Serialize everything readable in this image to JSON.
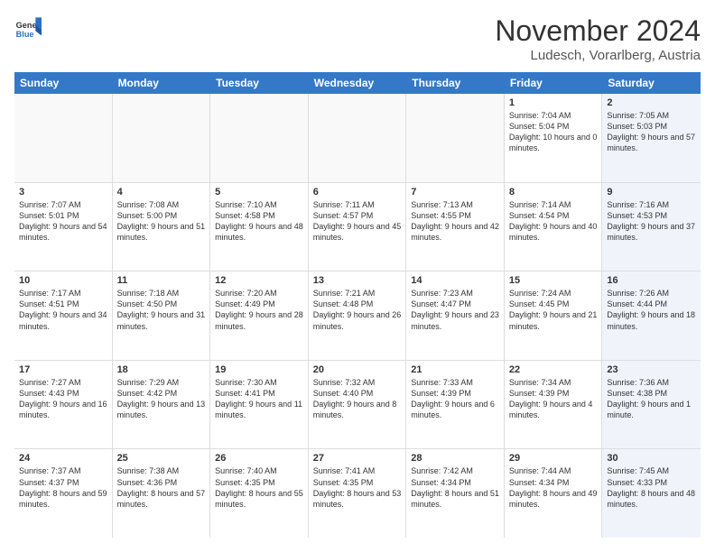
{
  "logo": {
    "general": "General",
    "blue": "Blue"
  },
  "header": {
    "month": "November 2024",
    "location": "Ludesch, Vorarlberg, Austria"
  },
  "weekdays": [
    "Sunday",
    "Monday",
    "Tuesday",
    "Wednesday",
    "Thursday",
    "Friday",
    "Saturday"
  ],
  "rows": [
    [
      {
        "day": "",
        "text": ""
      },
      {
        "day": "",
        "text": ""
      },
      {
        "day": "",
        "text": ""
      },
      {
        "day": "",
        "text": ""
      },
      {
        "day": "",
        "text": ""
      },
      {
        "day": "1",
        "text": "Sunrise: 7:04 AM\nSunset: 5:04 PM\nDaylight: 10 hours and 0 minutes."
      },
      {
        "day": "2",
        "text": "Sunrise: 7:05 AM\nSunset: 5:03 PM\nDaylight: 9 hours and 57 minutes."
      }
    ],
    [
      {
        "day": "3",
        "text": "Sunrise: 7:07 AM\nSunset: 5:01 PM\nDaylight: 9 hours and 54 minutes."
      },
      {
        "day": "4",
        "text": "Sunrise: 7:08 AM\nSunset: 5:00 PM\nDaylight: 9 hours and 51 minutes."
      },
      {
        "day": "5",
        "text": "Sunrise: 7:10 AM\nSunset: 4:58 PM\nDaylight: 9 hours and 48 minutes."
      },
      {
        "day": "6",
        "text": "Sunrise: 7:11 AM\nSunset: 4:57 PM\nDaylight: 9 hours and 45 minutes."
      },
      {
        "day": "7",
        "text": "Sunrise: 7:13 AM\nSunset: 4:55 PM\nDaylight: 9 hours and 42 minutes."
      },
      {
        "day": "8",
        "text": "Sunrise: 7:14 AM\nSunset: 4:54 PM\nDaylight: 9 hours and 40 minutes."
      },
      {
        "day": "9",
        "text": "Sunrise: 7:16 AM\nSunset: 4:53 PM\nDaylight: 9 hours and 37 minutes."
      }
    ],
    [
      {
        "day": "10",
        "text": "Sunrise: 7:17 AM\nSunset: 4:51 PM\nDaylight: 9 hours and 34 minutes."
      },
      {
        "day": "11",
        "text": "Sunrise: 7:18 AM\nSunset: 4:50 PM\nDaylight: 9 hours and 31 minutes."
      },
      {
        "day": "12",
        "text": "Sunrise: 7:20 AM\nSunset: 4:49 PM\nDaylight: 9 hours and 28 minutes."
      },
      {
        "day": "13",
        "text": "Sunrise: 7:21 AM\nSunset: 4:48 PM\nDaylight: 9 hours and 26 minutes."
      },
      {
        "day": "14",
        "text": "Sunrise: 7:23 AM\nSunset: 4:47 PM\nDaylight: 9 hours and 23 minutes."
      },
      {
        "day": "15",
        "text": "Sunrise: 7:24 AM\nSunset: 4:45 PM\nDaylight: 9 hours and 21 minutes."
      },
      {
        "day": "16",
        "text": "Sunrise: 7:26 AM\nSunset: 4:44 PM\nDaylight: 9 hours and 18 minutes."
      }
    ],
    [
      {
        "day": "17",
        "text": "Sunrise: 7:27 AM\nSunset: 4:43 PM\nDaylight: 9 hours and 16 minutes."
      },
      {
        "day": "18",
        "text": "Sunrise: 7:29 AM\nSunset: 4:42 PM\nDaylight: 9 hours and 13 minutes."
      },
      {
        "day": "19",
        "text": "Sunrise: 7:30 AM\nSunset: 4:41 PM\nDaylight: 9 hours and 11 minutes."
      },
      {
        "day": "20",
        "text": "Sunrise: 7:32 AM\nSunset: 4:40 PM\nDaylight: 9 hours and 8 minutes."
      },
      {
        "day": "21",
        "text": "Sunrise: 7:33 AM\nSunset: 4:39 PM\nDaylight: 9 hours and 6 minutes."
      },
      {
        "day": "22",
        "text": "Sunrise: 7:34 AM\nSunset: 4:39 PM\nDaylight: 9 hours and 4 minutes."
      },
      {
        "day": "23",
        "text": "Sunrise: 7:36 AM\nSunset: 4:38 PM\nDaylight: 9 hours and 1 minute."
      }
    ],
    [
      {
        "day": "24",
        "text": "Sunrise: 7:37 AM\nSunset: 4:37 PM\nDaylight: 8 hours and 59 minutes."
      },
      {
        "day": "25",
        "text": "Sunrise: 7:38 AM\nSunset: 4:36 PM\nDaylight: 8 hours and 57 minutes."
      },
      {
        "day": "26",
        "text": "Sunrise: 7:40 AM\nSunset: 4:35 PM\nDaylight: 8 hours and 55 minutes."
      },
      {
        "day": "27",
        "text": "Sunrise: 7:41 AM\nSunset: 4:35 PM\nDaylight: 8 hours and 53 minutes."
      },
      {
        "day": "28",
        "text": "Sunrise: 7:42 AM\nSunset: 4:34 PM\nDaylight: 8 hours and 51 minutes."
      },
      {
        "day": "29",
        "text": "Sunrise: 7:44 AM\nSunset: 4:34 PM\nDaylight: 8 hours and 49 minutes."
      },
      {
        "day": "30",
        "text": "Sunrise: 7:45 AM\nSunset: 4:33 PM\nDaylight: 8 hours and 48 minutes."
      }
    ]
  ]
}
